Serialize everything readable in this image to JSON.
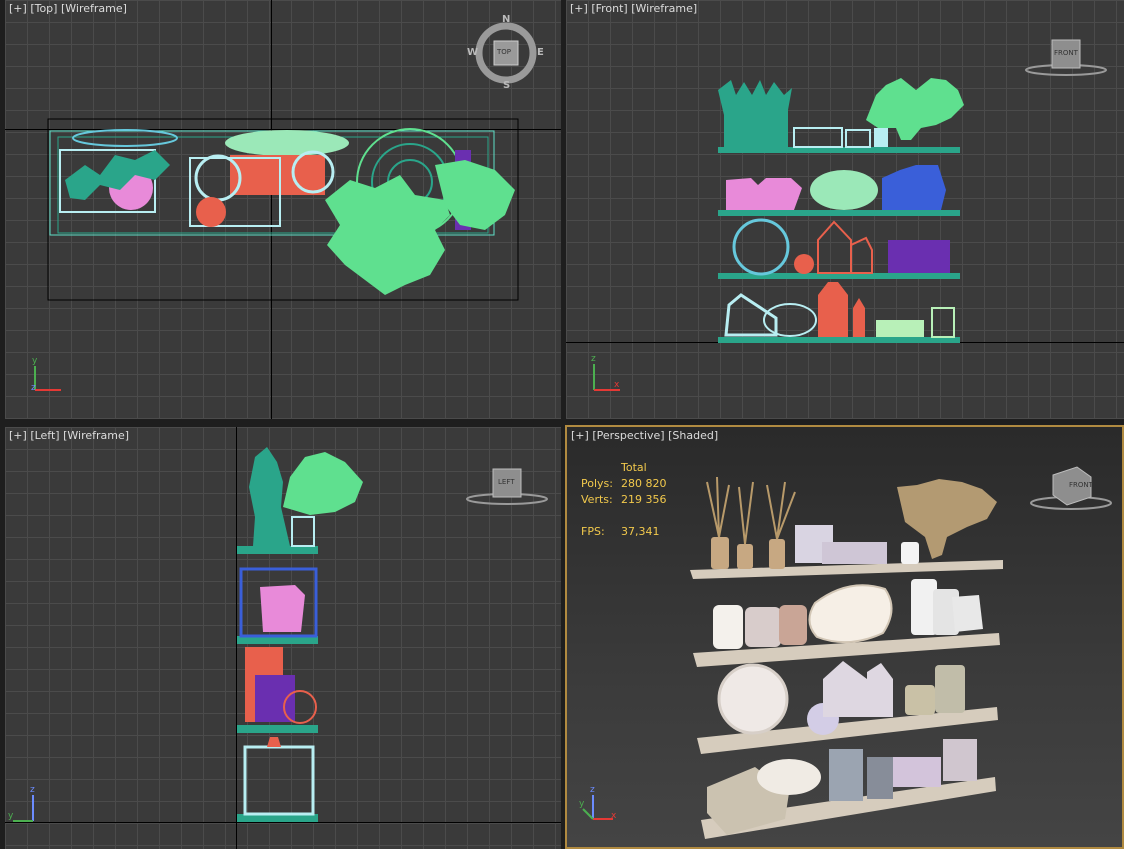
{
  "viewports": {
    "top": {
      "plus": "[+]",
      "view": "[Top]",
      "mode": "[Wireframe]",
      "cube": "TOP",
      "compass": {
        "n": "N",
        "s": "S",
        "e": "E",
        "w": "W"
      }
    },
    "front": {
      "plus": "[+]",
      "view": "[Front]",
      "mode": "[Wireframe]",
      "cube": "FRONT"
    },
    "left": {
      "plus": "[+]",
      "view": "[Left]",
      "mode": "[Wireframe]",
      "cube": "LEFT"
    },
    "perspective": {
      "plus": "[+]",
      "view": "[Perspective]",
      "mode": "[Shaded]",
      "cube": "FRONT"
    }
  },
  "stats": {
    "header": "Total",
    "polys_label": "Polys:",
    "polys_value": "280 820",
    "verts_label": "Verts:",
    "verts_value": "219 356",
    "fps_label": "FPS:",
    "fps_value": "37,341"
  },
  "axis": {
    "x": "x",
    "y": "y",
    "z": "z"
  },
  "colors": {
    "teal": "#2aa58a",
    "mint": "#5fe08f",
    "cyan": "#66c8dc",
    "salmon": "#e8604c",
    "pink": "#e88ad9",
    "blue": "#3a5fd9",
    "purple": "#6a2fb0",
    "active_border": "#b08a40"
  }
}
